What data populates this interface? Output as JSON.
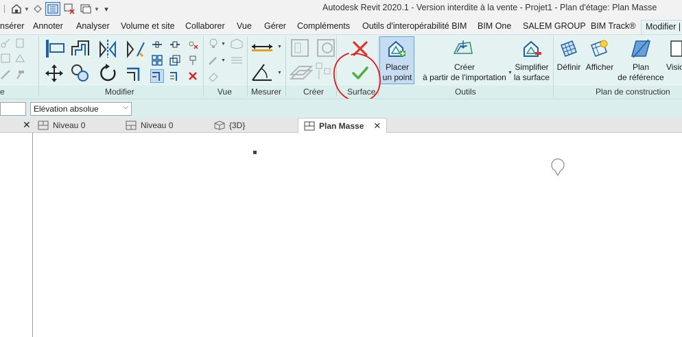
{
  "window": {
    "title": "Autodesk Revit 2020.1 - Version interdite à la vente - Projet1 - Plan d'étage: Plan Masse"
  },
  "quick_access": {
    "icons": [
      "home-icon",
      "sync-icon",
      "view-list-icon",
      "close-window-icon",
      "window-switch-icon",
      "more-dropdown-icon"
    ]
  },
  "tabs": [
    {
      "label": "nsérer"
    },
    {
      "label": "Annoter"
    },
    {
      "label": "Analyser"
    },
    {
      "label": "Volume et site"
    },
    {
      "label": "Collaborer"
    },
    {
      "label": "Vue"
    },
    {
      "label": "Gérer"
    },
    {
      "label": "Compléments"
    },
    {
      "label": "Outils d'interopérabilité BIM"
    },
    {
      "label": "BIM One"
    },
    {
      "label": "SALEM GROUP"
    },
    {
      "label": "BIM Track®"
    },
    {
      "label": "Modifier |"
    }
  ],
  "panels": {
    "left_cut": "e",
    "modifier": "Modifier",
    "vue": "Vue",
    "mesurer": "Mesurer",
    "creer": "Créer",
    "surface": "Surface",
    "outils": "Outils",
    "plan_construction": "Plan de construction"
  },
  "buttons": {
    "placer_line1": "Placer",
    "placer_line2": "un point",
    "creer_line1": "Créer",
    "creer_line2": "à partir de l'importation",
    "simplifier_line1": "Simplifier",
    "simplifier_line2": "la surface",
    "definir": "Définir",
    "afficher": "Afficher",
    "plan_line1": "Plan",
    "plan_line2": "de référence",
    "visio": "Visio"
  },
  "options_bar": {
    "elevation_select": "Elévation absolue"
  },
  "view_tabs": [
    {
      "label": "Niveau 0"
    },
    {
      "label": "Niveau 0"
    },
    {
      "label": "{3D}"
    },
    {
      "label": "Plan Masse"
    }
  ],
  "colors": {
    "ribbon_bg": "#e4f2f2",
    "accent_blue": "#2f6fbf",
    "finish_green": "#4caf3a",
    "cancel_red": "#e0352b",
    "annotation_red": "#e01818"
  }
}
